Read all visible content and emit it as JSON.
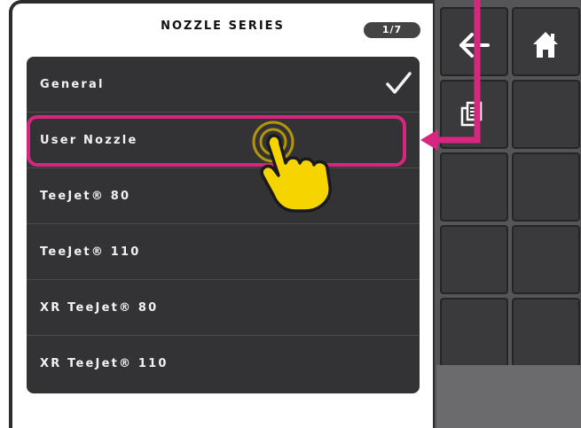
{
  "header": {
    "title": "NOZZLE SERIES",
    "page_indicator": "1/7"
  },
  "list": {
    "items": [
      {
        "label": "General",
        "checked": true
      },
      {
        "label": "User Nozzle",
        "checked": false,
        "highlighted": true
      },
      {
        "label": "TeeJet® 80",
        "checked": false
      },
      {
        "label": "TeeJet® 110",
        "checked": false
      },
      {
        "label": "XR TeeJet® 80",
        "checked": false
      },
      {
        "label": "XR TeeJet® 110",
        "checked": false
      }
    ]
  },
  "side_panel": {
    "buttons": [
      {
        "name": "back-button",
        "icon": "back-arrow-icon"
      },
      {
        "name": "home-button",
        "icon": "home-icon"
      },
      {
        "name": "copy-button",
        "icon": "copy-icon"
      },
      {
        "name": "empty-button"
      },
      {
        "name": "empty-button"
      },
      {
        "name": "empty-button"
      },
      {
        "name": "empty-button"
      },
      {
        "name": "empty-button"
      },
      {
        "name": "empty-button"
      },
      {
        "name": "empty-button"
      }
    ]
  },
  "colors": {
    "accent_callout": "#d6267f",
    "hand": "#f5d400",
    "list_bg": "#333335",
    "side_bg": "#555558"
  }
}
